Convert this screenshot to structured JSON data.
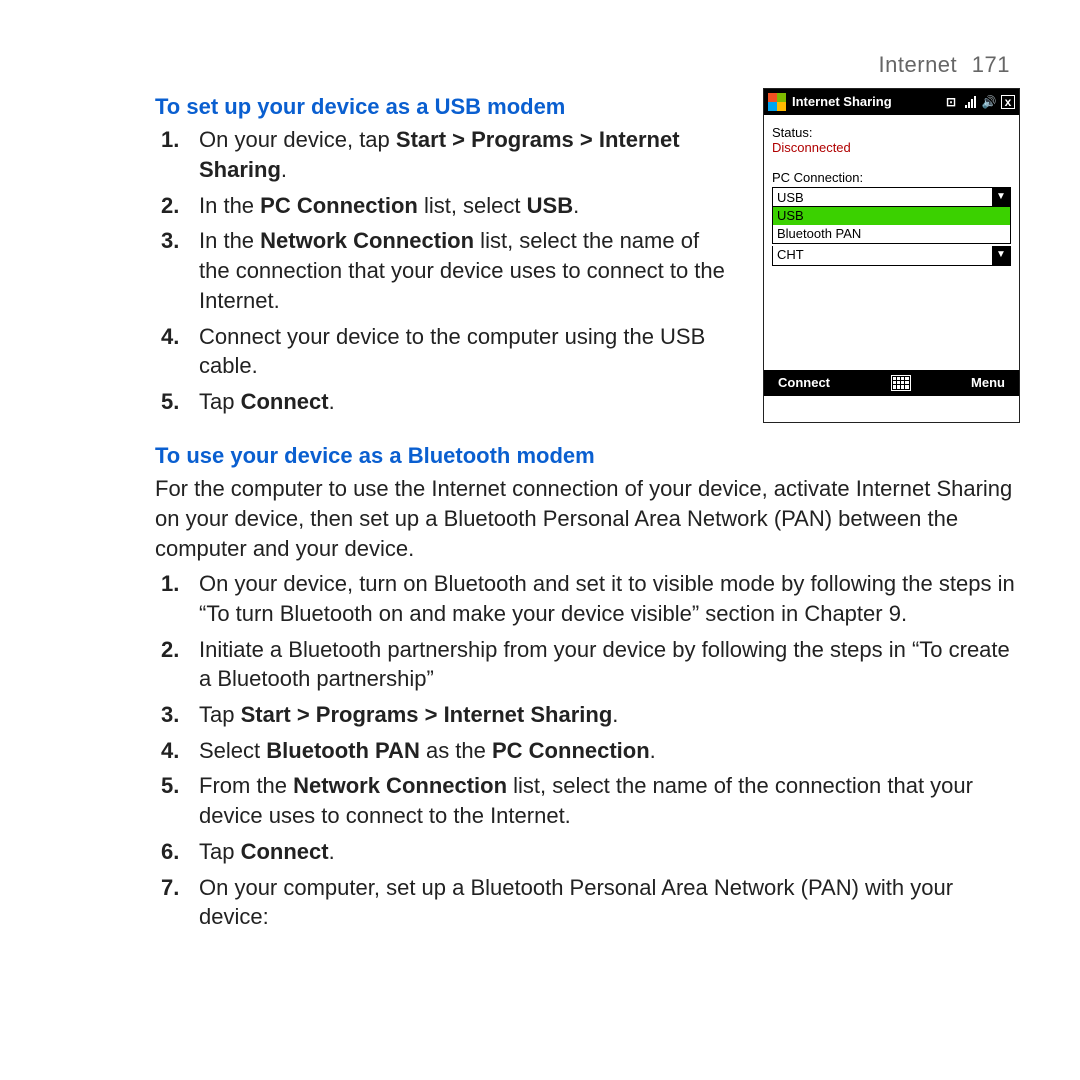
{
  "header": {
    "section": "Internet",
    "page": "171"
  },
  "usb": {
    "title": "To set up your device as a USB modem",
    "steps": {
      "s1a": "On your device, tap ",
      "s1b": "Start > Programs > Internet Sharing",
      "s1c": ".",
      "s2a": "In the ",
      "s2b": "PC Connection",
      "s2c": " list, select ",
      "s2d": "USB",
      "s2e": ".",
      "s3a": "In the ",
      "s3b": "Network Connection",
      "s3c": " list, select the name of the connection that your device uses to connect to the Internet.",
      "s4": "Connect your device to the computer using the USB cable.",
      "s5a": "Tap ",
      "s5b": "Connect",
      "s5c": "."
    }
  },
  "bt": {
    "title": "To use your device as a Bluetooth modem",
    "intro": "For the computer to use the Internet connection of your device, activate Internet Sharing on your device, then set up a Bluetooth Personal Area Network (PAN) between the computer and your device.",
    "steps": {
      "s1": "On your device, turn on Bluetooth and set it to visible mode by following the steps in “To turn Bluetooth on and make your device visible” section in Chapter 9.",
      "s2": "Initiate a Bluetooth partnership from your device by following the steps in “To create a Bluetooth partnership”",
      "s3a": "Tap ",
      "s3b": "Start > Programs > Internet Sharing",
      "s3c": ".",
      "s4a": "Select ",
      "s4b": "Bluetooth PAN",
      "s4c": " as the ",
      "s4d": "PC Connection",
      "s4e": ".",
      "s5a": "From the ",
      "s5b": "Network Connection",
      "s5c": " list, select the name of the connection that your device uses to connect to the Internet.",
      "s6a": "Tap ",
      "s6b": "Connect",
      "s6c": ".",
      "s7": "On your computer, set up a Bluetooth Personal Area Network (PAN) with your device:"
    }
  },
  "device": {
    "title": "Internet Sharing",
    "status_label": "Status:",
    "status_value": "Disconnected",
    "pc_label": "PC Connection:",
    "pc_value": "USB",
    "pc_options": {
      "o1": "USB",
      "o2": "Bluetooth PAN"
    },
    "net_value": "CHT",
    "softkey_left": "Connect",
    "softkey_right": "Menu",
    "icons": {
      "close": "x"
    }
  }
}
